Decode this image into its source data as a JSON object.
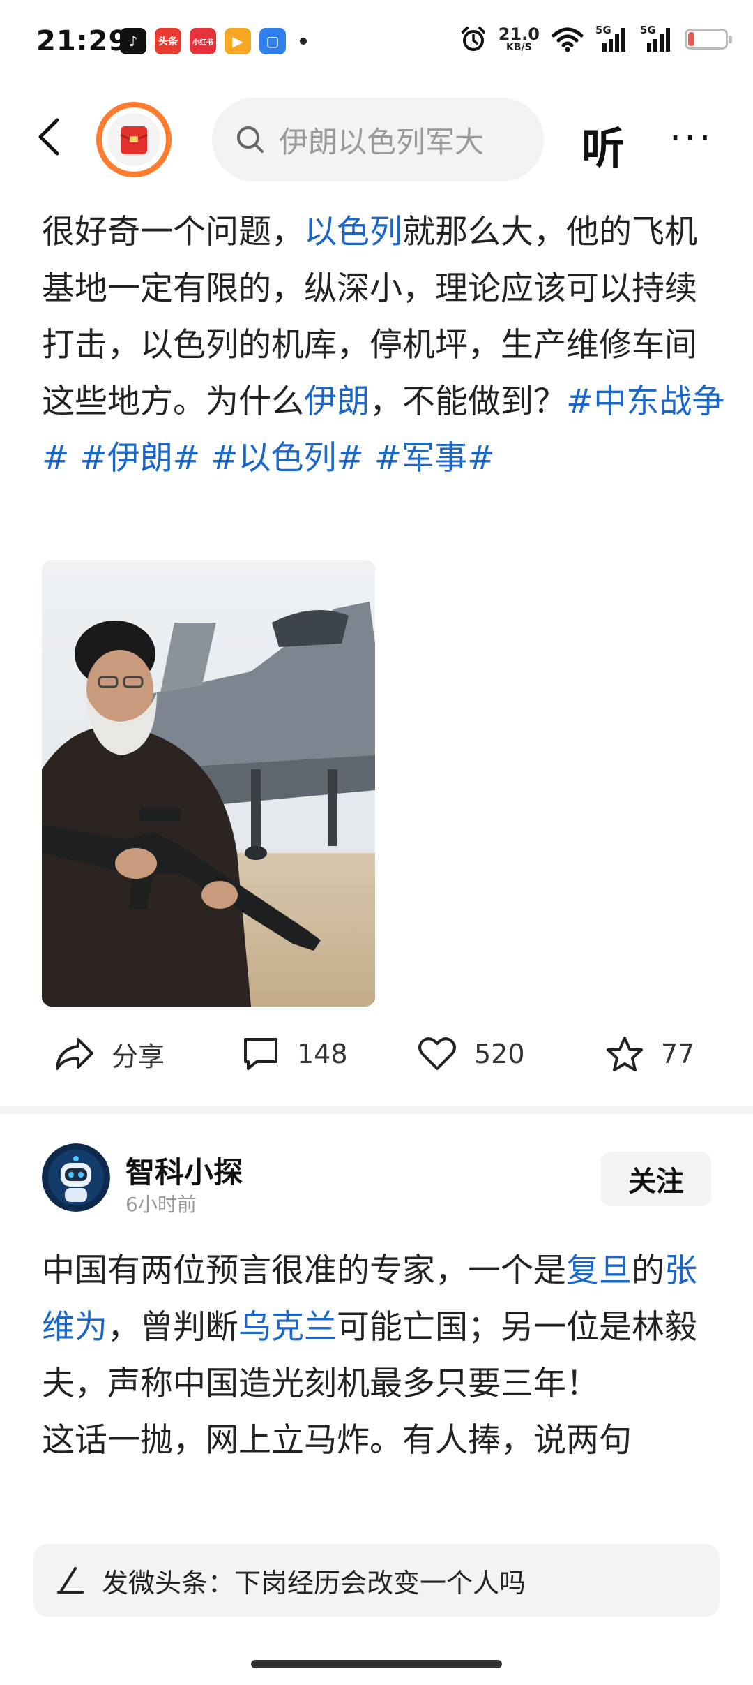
{
  "status_bar": {
    "time": "21:29",
    "app_icons": [
      {
        "name": "tiktok-icon",
        "label": "♪",
        "color": "#111111"
      },
      {
        "name": "toutiao-icon",
        "label": "头条",
        "color": "#e83a2f"
      },
      {
        "name": "xiaohongshu-icon",
        "label": "小红书",
        "color": "#e5323c"
      },
      {
        "name": "video-app-icon",
        "label": "▶",
        "color": "#f5a623"
      },
      {
        "name": "files-app-icon",
        "label": "▢",
        "color": "#2f80ed"
      }
    ],
    "net_speed_value": "21.0",
    "net_speed_unit": "KB/S",
    "signal1_label": "5G",
    "signal2_label": "5G",
    "battery_level": "17"
  },
  "top_nav": {
    "search_placeholder": "伊朗以色列军大",
    "listen_label": "听",
    "more_label": "···"
  },
  "post": {
    "text_segments": [
      {
        "text": "很好奇一个问题，",
        "link": false
      },
      {
        "text": "以色列",
        "link": true
      },
      {
        "text": "就那么大，他的飞机基地一定有限的，纵深小，理论应该可以持续打击，以色列的机库，停机坪，生产维修车间这些地方。为什么",
        "link": false
      },
      {
        "text": "伊朗",
        "link": true
      },
      {
        "text": "，不能做到？",
        "link": false
      },
      {
        "text": "#中东战争#",
        "link": true
      },
      {
        "text": " ",
        "link": false
      },
      {
        "text": "#伊朗#",
        "link": true
      },
      {
        "text": " ",
        "link": false
      },
      {
        "text": "#以色列#",
        "link": true
      },
      {
        "text": " ",
        "link": false
      },
      {
        "text": "#军事#",
        "link": true
      }
    ],
    "actions": {
      "share_label": "分享",
      "comment_count": "148",
      "like_count": "520",
      "favorite_count": "77"
    }
  },
  "post2": {
    "author_name": "智科小探",
    "time_ago": "6小时前",
    "follow_label": "关注",
    "text_segments": [
      {
        "text": "中国有两位预言很准的专家，一个是",
        "link": false
      },
      {
        "text": "复旦",
        "link": true
      },
      {
        "text": "的",
        "link": false
      },
      {
        "text": "张维为",
        "link": true
      },
      {
        "text": "，曾判断",
        "link": false
      },
      {
        "text": "乌克兰",
        "link": true
      },
      {
        "text": "可能亡国；另一位是林毅夫，声称中国造光刻机最多只要三年！",
        "link": false
      },
      {
        "text": "\n这话一抛，网上立马炸。有人捧，说两句",
        "link": false
      }
    ]
  },
  "compose_bar": {
    "text": "发微头条：下岗经历会改变一个人吗"
  },
  "colors": {
    "link": "#1b67c9",
    "accent_orange": "#ff7b2e",
    "battery_low": "#e0584f"
  }
}
